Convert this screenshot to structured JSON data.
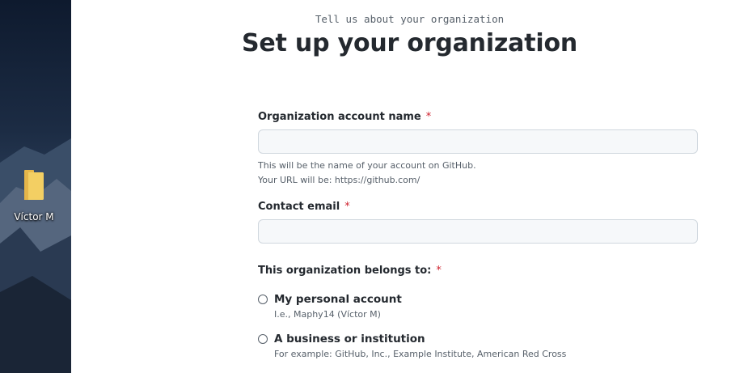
{
  "desktop": {
    "folder_label": "Víctor M"
  },
  "header": {
    "subtitle": "Tell us about your organization",
    "title": "Set up your organization"
  },
  "form": {
    "org_name": {
      "label": "Organization account name",
      "required_mark": "*",
      "value": "",
      "help_line1": "This will be the name of your account on GitHub.",
      "help_line2": "Your URL will be: https://github.com/"
    },
    "contact_email": {
      "label": "Contact email",
      "required_mark": "*",
      "value": ""
    },
    "belongs_to": {
      "label": "This organization belongs to:",
      "required_mark": "*",
      "options": [
        {
          "label": "My personal account",
          "note": "I.e., Maphy14 (Víctor M)",
          "selected": false
        },
        {
          "label": "A business or institution",
          "note": "For example: GitHub, Inc., Example Institute, American Red Cross",
          "selected": false
        }
      ]
    }
  },
  "colors": {
    "required": "#cf222e",
    "input_bg": "#f6f8fa",
    "input_border": "#d0d7de",
    "muted_text": "#57606a"
  }
}
